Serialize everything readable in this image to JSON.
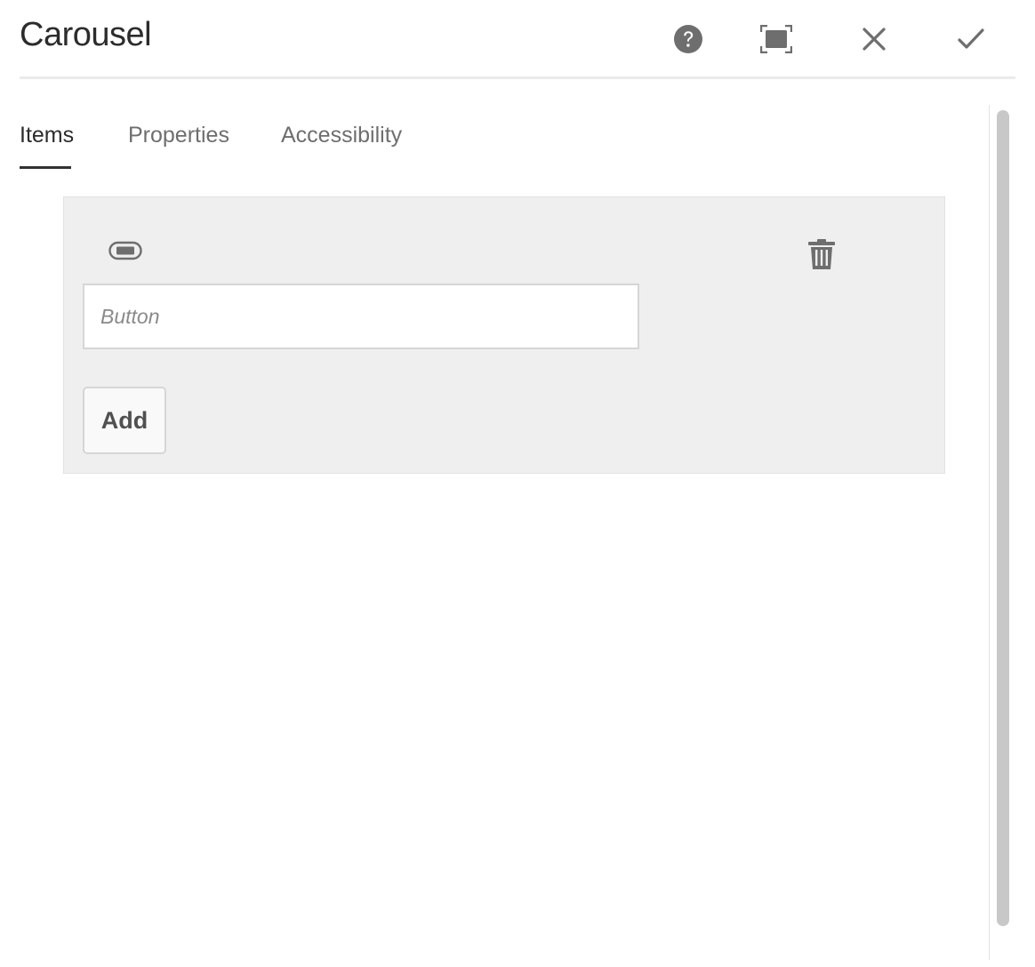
{
  "dialog": {
    "title": "Carousel",
    "actions": [
      {
        "name": "help",
        "icon": "help-icon"
      },
      {
        "name": "fullscreen",
        "icon": "fullscreen-icon"
      },
      {
        "name": "cancel",
        "icon": "close-icon"
      },
      {
        "name": "done",
        "icon": "checkmark-icon"
      }
    ]
  },
  "tabs": [
    {
      "label": "Items",
      "active": true
    },
    {
      "label": "Properties",
      "active": false
    },
    {
      "label": "Accessibility",
      "active": false
    }
  ],
  "items_panel": {
    "item_icon": "button-component-icon",
    "delete_icon": "trash-icon",
    "input": {
      "value": "",
      "placeholder": "Button"
    },
    "add_label": "Add"
  },
  "colors": {
    "icon": "#6e6e6e",
    "panel_background": "#efefef",
    "active_tab_underline": "#323232",
    "scrollbar_thumb": "#c8c8c8"
  }
}
